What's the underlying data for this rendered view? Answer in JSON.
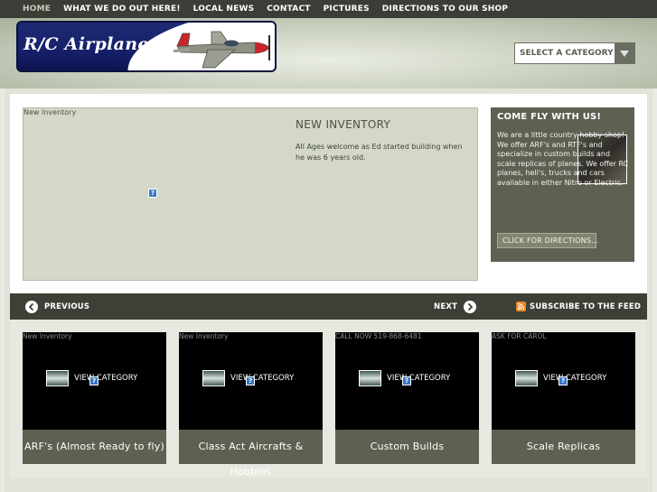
{
  "nav": {
    "items": [
      "HOME",
      "WHAT WE DO OUT HERE!",
      "LOCAL NEWS",
      "CONTACT",
      "PICTURES",
      "DIRECTIONS TO OUR SHOP"
    ],
    "active_index": 0
  },
  "header": {
    "logo_text": "R/C Airplanes",
    "category_select": "SELECT A CATEGORY"
  },
  "featured": {
    "small_caption": "New Inventory",
    "title": "NEW INVENTORY",
    "text": "All Ages welcome as Ed started building when he was 6 years old."
  },
  "sidebar": {
    "title": "COME FLY WITH US!",
    "text": "We are a little country hobby shop! We offer ARF's and RTF's and specialize in custom builds and scale replicas of planes. We offer RC planes, heli's, trucks and cars available in either Nitro or Electric.",
    "button": "CLICK FOR DIRECTIONS..."
  },
  "slider_nav": {
    "previous": "PREVIOUS",
    "next": "NEXT",
    "feed": "SUBSCRIBE TO THE FEED"
  },
  "cards": [
    {
      "caption": "New Inventory",
      "view_label": "VIEW CATEGORY",
      "title": "ARF's (Almost Ready to fly)"
    },
    {
      "caption": "New Inventory",
      "view_label": "VIEW CATEGORY",
      "title": "Class Act Aircrafts & Hobbies"
    },
    {
      "caption": "CALL NOW 519-868-6481",
      "view_label": "VIEW CATEGORY",
      "title": "Custom Builds"
    },
    {
      "caption": "ASK FOR CAROL",
      "view_label": "VIEW CATEGORY",
      "title": "Scale Replicas"
    }
  ],
  "colors": {
    "nav_bg": "#3b3e36",
    "panel": "#5d6152",
    "accent_rss": "#e98a20"
  }
}
